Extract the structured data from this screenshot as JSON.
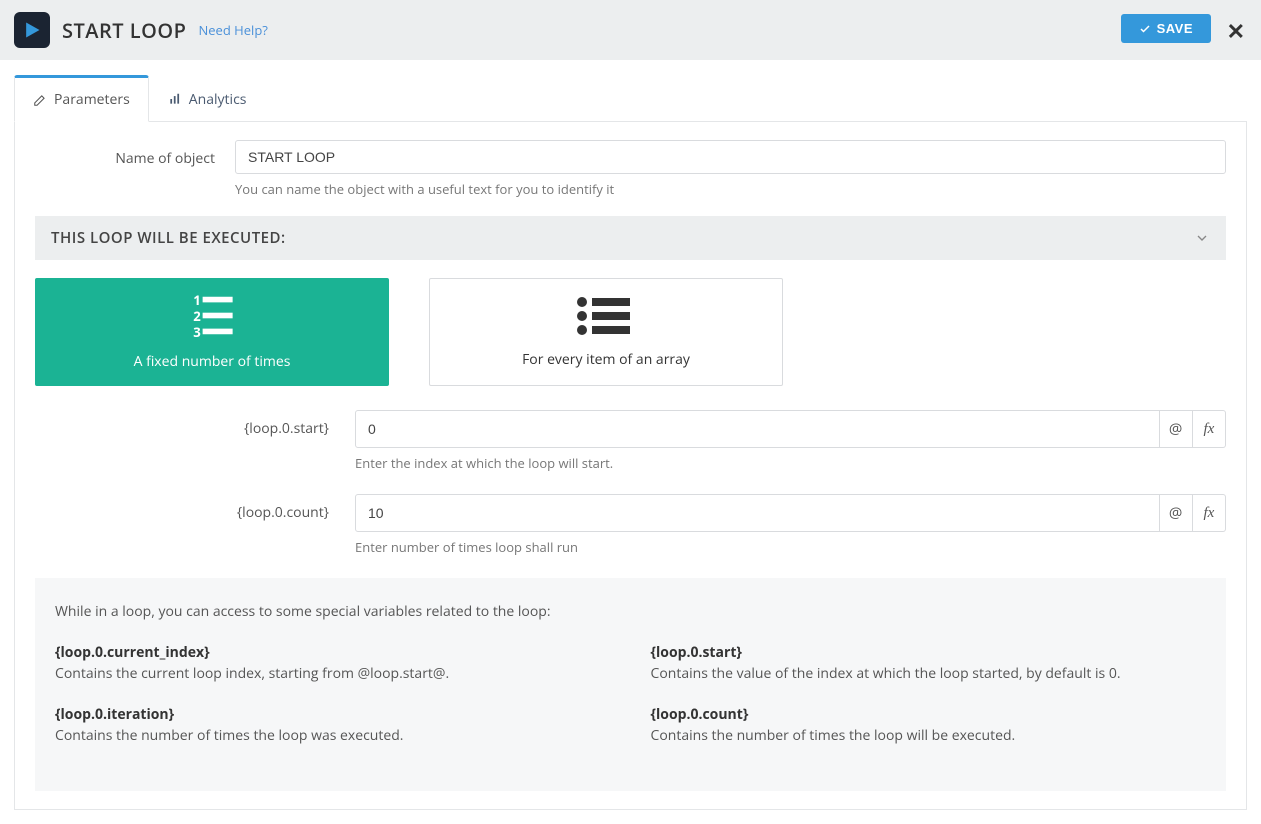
{
  "header": {
    "title": "START LOOP",
    "help_label": "Need Help?",
    "save_label": "SAVE"
  },
  "tabs": {
    "parameters": "Parameters",
    "analytics": "Analytics"
  },
  "name_field": {
    "label": "Name of object",
    "value": "START LOOP",
    "hint": "You can name the object with a useful text for you to identify it"
  },
  "section_title": "THIS LOOP WILL BE EXECUTED:",
  "mode_cards": {
    "fixed": "A fixed number of times",
    "array": "For every item of an array"
  },
  "fields": {
    "start": {
      "label": "{loop.0.start}",
      "value": "0",
      "hint": "Enter the index at which the loop will start."
    },
    "count": {
      "label": "{loop.0.count}",
      "value": "10",
      "hint": "Enter number of times loop shall run"
    }
  },
  "addon_at": "@",
  "addon_fx": "fx",
  "info": {
    "intro": "While in a loop, you can access to some special variables related to the loop:",
    "var1": {
      "name": "{loop.0.current_index}",
      "desc": "Contains the current loop index, starting from @loop.start@."
    },
    "var2": {
      "name": "{loop.0.iteration}",
      "desc": "Contains the number of times the loop was executed."
    },
    "var3": {
      "name": "{loop.0.start}",
      "desc": "Contains the value of the index at which the loop started, by default is 0."
    },
    "var4": {
      "name": "{loop.0.count}",
      "desc": "Contains the number of times the loop will be executed."
    }
  }
}
